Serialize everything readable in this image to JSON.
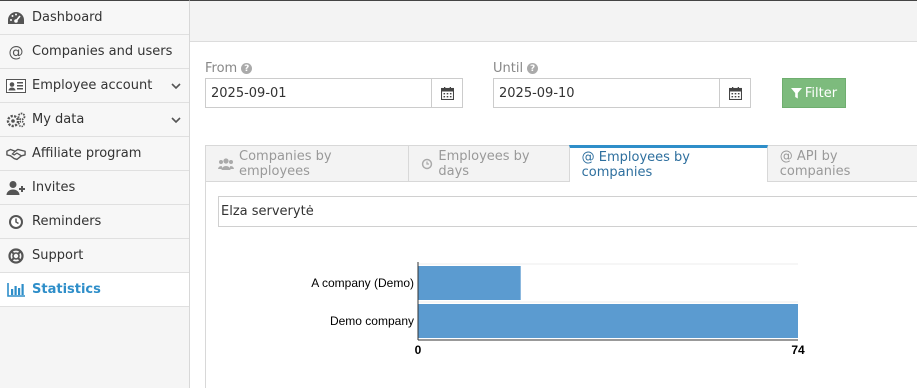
{
  "sidebar": {
    "items": [
      {
        "label": "Dashboard",
        "icon": "dashboard-icon"
      },
      {
        "label": "Companies and users",
        "icon": "at-icon"
      },
      {
        "label": "Employee account",
        "icon": "id-card-icon",
        "expandable": true
      },
      {
        "label": "My data",
        "icon": "cogs-icon",
        "expandable": true
      },
      {
        "label": "Affiliate program",
        "icon": "handshake-icon"
      },
      {
        "label": "Invites",
        "icon": "user-plus-icon"
      },
      {
        "label": "Reminders",
        "icon": "clock-icon"
      },
      {
        "label": "Support",
        "icon": "life-ring-icon"
      },
      {
        "label": "Statistics",
        "icon": "bar-chart-icon",
        "active": true
      }
    ]
  },
  "filters": {
    "from_label": "From",
    "from_value": "2025-09-01",
    "until_label": "Until",
    "until_value": "2025-09-10",
    "filter_label": "Filter"
  },
  "tabs": [
    {
      "label": "Companies by employees",
      "icon": "users-icon"
    },
    {
      "label": "Employees by days",
      "icon": "clock-icon"
    },
    {
      "label": "@ Employees by companies",
      "active": true
    },
    {
      "label": "@ API by companies"
    }
  ],
  "panel": {
    "selected_user": "Elza serverytė"
  },
  "colors": {
    "accent": "#2e8ec9",
    "bar": "#5b9bd0",
    "filter_button": "#7dbb7d"
  },
  "chart_data": {
    "type": "bar",
    "orientation": "horizontal",
    "categories": [
      "A company (Demo)",
      "Demo company"
    ],
    "values": [
      20,
      74
    ],
    "xlim": [
      0,
      74
    ],
    "xticks": [
      "0",
      "74"
    ],
    "grid": false
  }
}
